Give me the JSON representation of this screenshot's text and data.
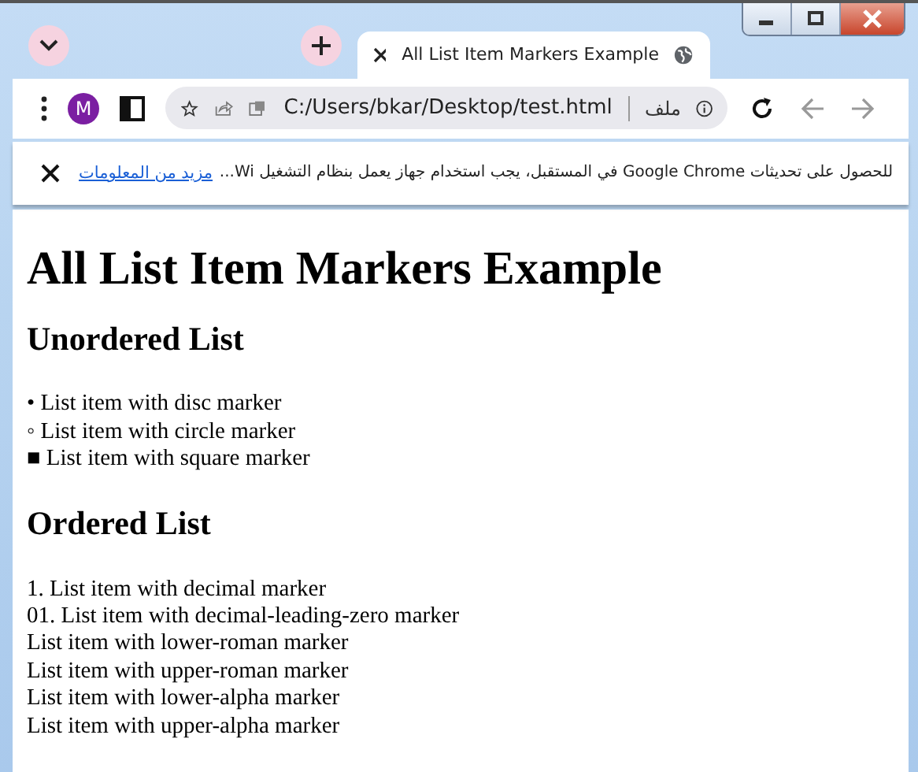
{
  "tab": {
    "title": "All List Item Markers Example",
    "selected": true
  },
  "toolbar": {
    "avatar": "M",
    "address": "C:/Users/bkar/Desktop/test.html",
    "scheme_label": "ملف"
  },
  "infobar": {
    "message": "للحصول على تحديثات Google Chrome في المستقبل، يجب استخدام جهاز يعمل بنظام التشغيل Wi...",
    "link": "مزيد من المعلومات"
  },
  "page": {
    "title": "All List Item Markers Example",
    "sections": [
      {
        "heading": "Unordered List",
        "items": [
          "• List item with disc marker",
          "◦ List item with circle marker",
          "■ List item with square marker"
        ]
      },
      {
        "heading": "Ordered List",
        "items": [
          "1. List item with decimal marker",
          "01. List item with decimal-leading-zero marker",
          "List item with lower-roman marker",
          "List item with upper-roman marker",
          "List item with lower-alpha marker",
          "List item with upper-alpha marker"
        ]
      }
    ]
  }
}
